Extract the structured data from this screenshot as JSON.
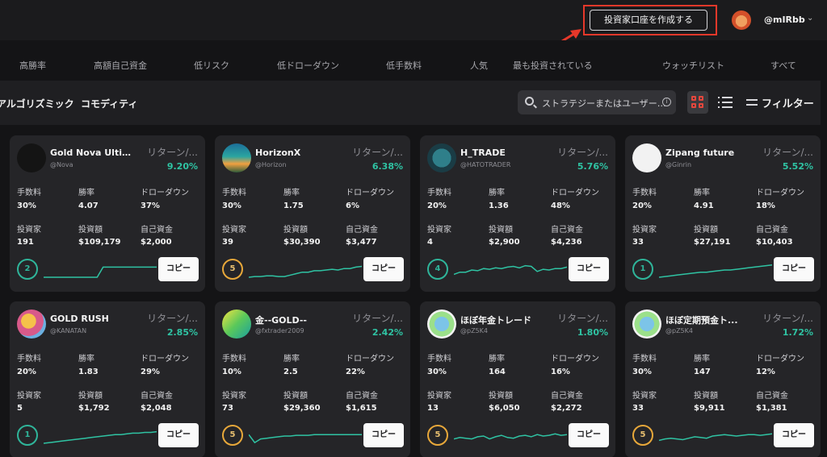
{
  "header": {
    "create_button": "投資家口座を作成する",
    "username": "@mIRbb",
    "accent": "#e6382a"
  },
  "tabs": [
    "高勝率",
    "高額自己資金",
    "低リスク",
    "低ドローダウン",
    "低手数料",
    "人気",
    "最も投資されている",
    "ウォッチリスト",
    "すべて"
  ],
  "subtabs": [
    "アルゴリズミック",
    "コモディティ"
  ],
  "search": {
    "placeholder": "ストラテジーまたはユーザー…"
  },
  "filter_label": "フィルター",
  "labels": {
    "return": "リターン/...",
    "fee": "手数料",
    "win_rate": "勝率",
    "drawdown": "ドローダウン",
    "investors": "投資家",
    "invested": "投資額",
    "own_funds": "自己資金",
    "copy": "コピー"
  },
  "cards": [
    {
      "name": "Gold Nova Ultim...",
      "handle": "@Nova",
      "return": "9.20%",
      "fee": "30%",
      "win_rate": "4.07",
      "drawdown": "37%",
      "investors": "191",
      "invested": "$109,179",
      "own_funds": "$2,000",
      "rank": "2",
      "rank_color": "teal",
      "avatar": "gold-nova-logo",
      "spark": [
        0,
        0,
        0,
        0,
        0,
        0,
        0,
        0,
        0,
        0,
        0.7,
        0.7,
        0.7,
        0.7,
        0.7,
        0.7,
        0.7,
        0.7,
        0.7,
        0.7
      ]
    },
    {
      "name": "HorizonX",
      "handle": "@Horizon",
      "return": "6.38%",
      "fee": "30%",
      "win_rate": "1.75",
      "drawdown": "6%",
      "investors": "39",
      "invested": "$30,390",
      "own_funds": "$3,477",
      "rank": "5",
      "rank_color": "gold",
      "avatar": "horizonx-logo",
      "spark": [
        0,
        0.05,
        0.05,
        0.1,
        0.1,
        0.05,
        0.05,
        0.15,
        0.25,
        0.35,
        0.35,
        0.45,
        0.45,
        0.5,
        0.55,
        0.5,
        0.6,
        0.6,
        0.7,
        0.75
      ]
    },
    {
      "name": "H_TRADE",
      "handle": "@HATOTRADER",
      "return": "5.76%",
      "fee": "20%",
      "win_rate": "1.36",
      "drawdown": "48%",
      "investors": "4",
      "invested": "$2,900",
      "own_funds": "$4,236",
      "rank": "4",
      "rank_color": "teal",
      "avatar": "hato-logo",
      "spark": [
        0.2,
        0.35,
        0.35,
        0.5,
        0.45,
        0.6,
        0.55,
        0.65,
        0.6,
        0.7,
        0.75,
        0.65,
        0.8,
        0.75,
        0.4,
        0.55,
        0.5,
        0.6,
        0.6,
        0.7
      ]
    },
    {
      "name": "Zipang future",
      "handle": "@Ginrin",
      "return": "5.52%",
      "fee": "20%",
      "win_rate": "4.91",
      "drawdown": "18%",
      "investors": "33",
      "invested": "$27,191",
      "own_funds": "$10,403",
      "rank": "1",
      "rank_color": "teal",
      "avatar": "zipang-logo",
      "spark": [
        0,
        0.05,
        0.1,
        0.15,
        0.2,
        0.25,
        0.3,
        0.35,
        0.35,
        0.4,
        0.45,
        0.5,
        0.5,
        0.55,
        0.6,
        0.65,
        0.7,
        0.75,
        0.8,
        0.85
      ]
    },
    {
      "name": "GOLD RUSH",
      "handle": "@KANATAN",
      "return": "2.85%",
      "fee": "20%",
      "win_rate": "1.83",
      "drawdown": "29%",
      "investors": "5",
      "invested": "$1,792",
      "own_funds": "$2,048",
      "rank": "1",
      "rank_color": "teal",
      "avatar": "gold-rush-avatar",
      "spark": [
        0,
        0.05,
        0.1,
        0.15,
        0.2,
        0.25,
        0.3,
        0.35,
        0.4,
        0.45,
        0.5,
        0.55,
        0.6,
        0.6,
        0.65,
        0.7,
        0.7,
        0.75,
        0.75,
        0.8
      ]
    },
    {
      "name": "金--GOLD--",
      "handle": "@fxtrader2009",
      "return": "2.42%",
      "fee": "10%",
      "win_rate": "2.5",
      "drawdown": "22%",
      "investors": "73",
      "invested": "$29,360",
      "own_funds": "$1,615",
      "rank": "5",
      "rank_color": "gold",
      "avatar": "fxtrader-logo",
      "spark": [
        0.6,
        0.05,
        0.3,
        0.35,
        0.4,
        0.45,
        0.5,
        0.5,
        0.55,
        0.55,
        0.55,
        0.6,
        0.6,
        0.6,
        0.6,
        0.6,
        0.6,
        0.6,
        0.6,
        0.6
      ]
    },
    {
      "name": "ほぼ年金トレード",
      "handle": "@pZ5K4",
      "return": "1.80%",
      "fee": "30%",
      "win_rate": "164",
      "drawdown": "16%",
      "investors": "13",
      "invested": "$6,050",
      "own_funds": "$2,272",
      "rank": "5",
      "rank_color": "gold",
      "avatar": "kenken-avatar",
      "spark": [
        0.3,
        0.4,
        0.35,
        0.3,
        0.45,
        0.5,
        0.3,
        0.45,
        0.55,
        0.4,
        0.35,
        0.5,
        0.55,
        0.45,
        0.6,
        0.5,
        0.55,
        0.65,
        0.55,
        0.6
      ]
    },
    {
      "name": "ほぼ定期預金ト...",
      "handle": "@pZ5K4",
      "return": "1.72%",
      "fee": "30%",
      "win_rate": "147",
      "drawdown": "12%",
      "investors": "33",
      "invested": "$9,911",
      "own_funds": "$1,381",
      "rank": "5",
      "rank_color": "gold",
      "avatar": "kenken-avatar",
      "spark": [
        0.2,
        0.3,
        0.35,
        0.3,
        0.25,
        0.35,
        0.45,
        0.4,
        0.35,
        0.5,
        0.55,
        0.6,
        0.55,
        0.5,
        0.55,
        0.6,
        0.6,
        0.55,
        0.6,
        0.65
      ]
    }
  ]
}
